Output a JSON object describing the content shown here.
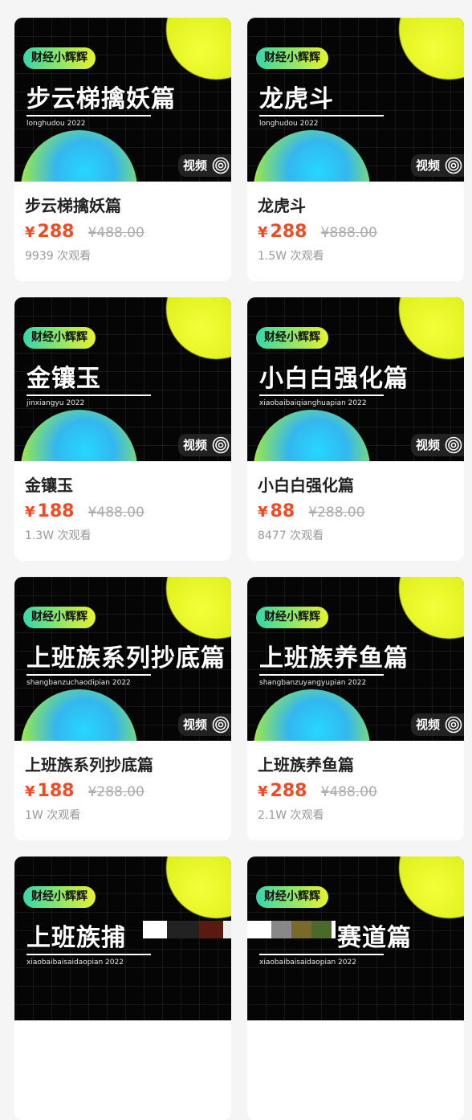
{
  "cards": [
    {
      "brand": "财经小辉辉",
      "thumb_title": "步云梯擒妖篇",
      "thumb_sub": "longhudou 2022",
      "badge": "视频",
      "name": "步云梯擒妖篇",
      "currency": "¥",
      "price": "288",
      "orig_price": "¥488.00",
      "views": "9939 次观看"
    },
    {
      "brand": "财经小辉辉",
      "thumb_title": "龙虎斗",
      "thumb_sub": "longhudou 2022",
      "badge": "视频",
      "name": "龙虎斗",
      "currency": "¥",
      "price": "288",
      "orig_price": "¥888.00",
      "views": "1.5W 次观看"
    },
    {
      "brand": "财经小辉辉",
      "thumb_title": "金镶玉",
      "thumb_sub": "jinxiangyu 2022",
      "badge": "视频",
      "name": "金镶玉",
      "currency": "¥",
      "price": "188",
      "orig_price": "¥488.00",
      "views": "1.3W 次观看"
    },
    {
      "brand": "财经小辉辉",
      "thumb_title": "小白白强化篇",
      "thumb_sub": "xiaobaibaiqianghuapian 2022",
      "badge": "视频",
      "name": "小白白强化篇",
      "currency": "¥",
      "price": "88",
      "orig_price": "¥288.00",
      "views": "8477 次观看"
    },
    {
      "brand": "财经小辉辉",
      "thumb_title": "上班族系列抄底篇",
      "thumb_sub": "shangbanzuchaodipian 2022",
      "badge": "视频",
      "name": "上班族系列抄底篇",
      "currency": "¥",
      "price": "188",
      "orig_price": "¥288.00",
      "views": "1W 次观看"
    },
    {
      "brand": "财经小辉辉",
      "thumb_title": "上班族养鱼篇",
      "thumb_sub": "shangbanzuyangyupian 2022",
      "badge": "视频",
      "name": "上班族养鱼篇",
      "currency": "¥",
      "price": "288",
      "orig_price": "¥488.00",
      "views": "2.1W 次观看"
    },
    {
      "brand": "财经小辉辉",
      "thumb_title": "上班族捕",
      "thumb_sub": "xiaobaibaisaidaopian 2022",
      "badge": "",
      "name": "",
      "currency": "",
      "price": "",
      "orig_price": "",
      "views": ""
    },
    {
      "brand": "财经小辉辉",
      "thumb_title": "赛道篇",
      "thumb_sub": "xiaobaibaisaidaopian 2022",
      "badge": "",
      "name": "",
      "currency": "",
      "price": "",
      "orig_price": "",
      "views": ""
    }
  ]
}
